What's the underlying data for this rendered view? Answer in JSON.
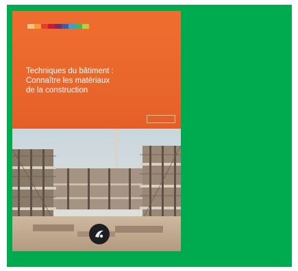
{
  "image": {
    "description": "Book cover on green background",
    "background_color": "#00ab4f",
    "cover_color": "#e9672e"
  },
  "cover": {
    "title_lines": [
      "Techniques du bâtiment :",
      "Connaître les matériaux",
      "de la construction"
    ],
    "photo_subject": "building-construction-site",
    "colorbar": [
      "#f6c48a",
      "#f59b3a",
      "#e43f2a",
      "#c21f36",
      "#7a2a6a",
      "#3b5bb0",
      "#2fa6d8",
      "#3fb56b",
      "#b7cf3a"
    ]
  }
}
